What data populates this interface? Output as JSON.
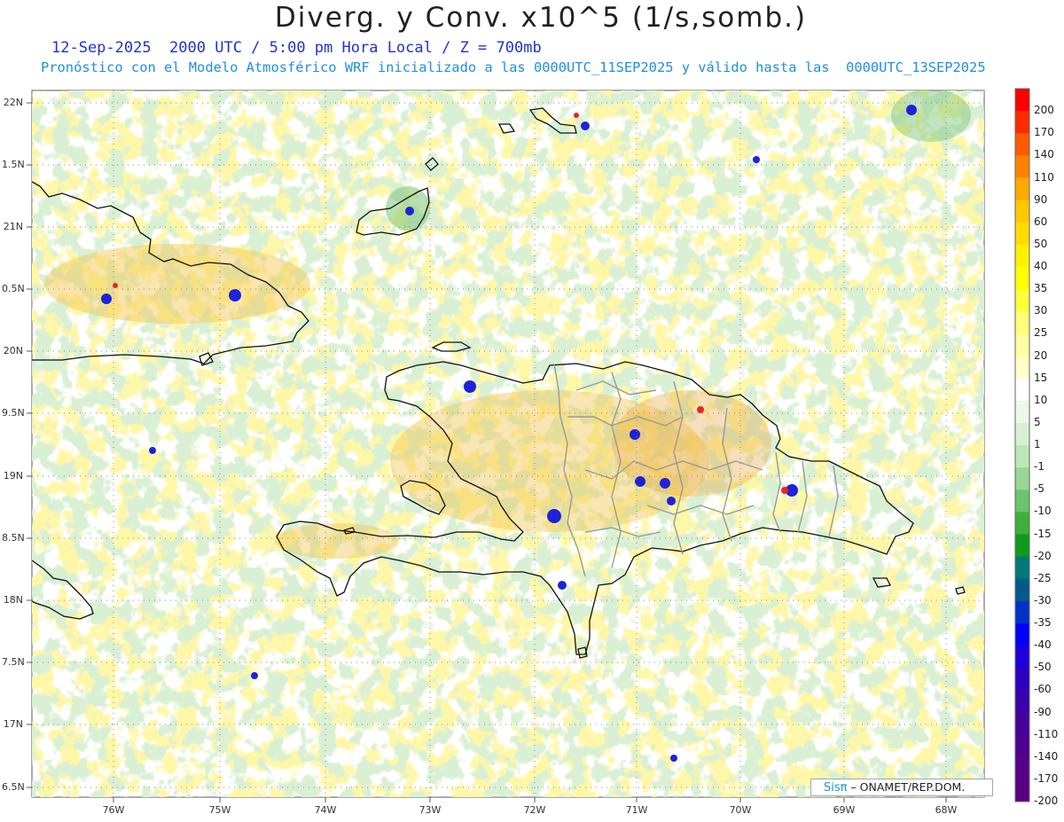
{
  "header": {
    "title": "Diverg. y Conv. x10^5 (1/s,somb.)",
    "subtitle": "12-Sep-2025  2000 UTC / 5:00 pm Hora Local / Z = 700mb",
    "model_line": "Pronóstico con el Modelo Atmosférico WRF inicializado a las 0000UTC_11SEP2025 y válido hasta las  0000UTC_13SEP2025"
  },
  "map": {
    "lat_labels": [
      "22N",
      "1.5N",
      "21N",
      "0.5N",
      "20N",
      "9.5N",
      "19N",
      "8.5N",
      "18N",
      "7.5N",
      "17N",
      "6.5N"
    ],
    "lon_labels": [
      "76W",
      "75W",
      "74W",
      "73W",
      "72W",
      "71W",
      "70W",
      "69W",
      "68W"
    ]
  },
  "colorbar": {
    "labels": [
      "200",
      "170",
      "140",
      "110",
      "90",
      "60",
      "50",
      "40",
      "35",
      "30",
      "25",
      "20",
      "15",
      "10",
      "5",
      "1",
      "-1",
      "-5",
      "-10",
      "-15",
      "-20",
      "-25",
      "-30",
      "-35",
      "-40",
      "-50",
      "-60",
      "-90",
      "-110",
      "-140",
      "-170",
      "-200"
    ],
    "colors": [
      "#ff0000",
      "#ff2a00",
      "#ff5a00",
      "#ff8200",
      "#ffaa00",
      "#ffc800",
      "#ffdc00",
      "#fff000",
      "#ffff00",
      "#ffff3c",
      "#ffff78",
      "#ffffa0",
      "#ffffc8",
      "#ffffff",
      "#eef8ea",
      "#d7f0d1",
      "#bde7b6",
      "#98d894",
      "#6cc46c",
      "#3cb03c",
      "#109a1e",
      "#007878",
      "#005a8c",
      "#0032c8",
      "#0000ff",
      "#1e00dc",
      "#2d00c0",
      "#3a00aa",
      "#45009a",
      "#500090",
      "#560088",
      "#5a0080"
    ]
  },
  "credit": {
    "logo": "Sisπ",
    "text": "– ONAMET/REP.DOM."
  }
}
